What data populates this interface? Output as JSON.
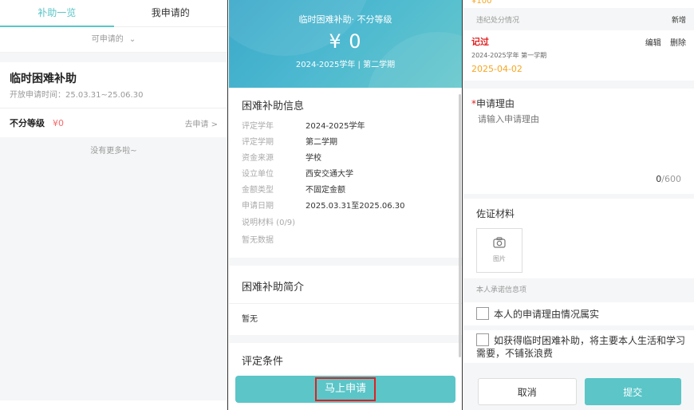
{
  "list": {
    "tabs": [
      "补助一览",
      "我申请的"
    ],
    "filter": "可申请的",
    "item": {
      "title": "临时困难补助",
      "open_time": "开放申请时间：25.03.31~25.06.30",
      "level": "不分等级",
      "amount": "¥0",
      "action": "去申请 >"
    },
    "no_more": "没有更多啦~"
  },
  "detail": {
    "banner_title": "临时困难补助· 不分等级",
    "banner_amount": "¥ 0",
    "banner_term": "2024-2025学年 | 第二学期",
    "info_title": "困难补助信息",
    "info": [
      {
        "k": "评定学年",
        "v": "2024-2025学年"
      },
      {
        "k": "评定学期",
        "v": "第二学期"
      },
      {
        "k": "资金来源",
        "v": "学校"
      },
      {
        "k": "设立单位",
        "v": "西安交通大学"
      },
      {
        "k": "金额类型",
        "v": "不固定金额"
      },
      {
        "k": "申请日期",
        "v": "2025.03.31至2025.06.30"
      }
    ],
    "materials": "说明材料 (0/9)",
    "no_data": "暂无数据",
    "brief_title": "困难补助简介",
    "brief": "暂无",
    "cond_title": "评定条件",
    "apply_button": "马上申请"
  },
  "form": {
    "top_amount": "¥100",
    "violation_head": "违纪处分情况",
    "add": "新增",
    "violation": {
      "type": "记过",
      "edit": "编辑",
      "delete": "删除",
      "term": "2024-2025学年 第一学期",
      "date": "2025-04-02"
    },
    "reason_label": "申请理由",
    "reason_placeholder": "请输入申请理由",
    "counter_current": "0",
    "counter_max": "/600",
    "evidence_label": "佐证材料",
    "evidence_caption": "图片",
    "promise_head": "本人承诺信息项",
    "promise1": "本人的申请理由情况属实",
    "promise2": "如获得临时困难补助，将主要本人生活和学习需要，不铺张浪费",
    "cancel": "取消",
    "submit": "提交"
  },
  "colors": {
    "accent": "#5bc5c8",
    "red": "#e02020",
    "orange": "#f5a623"
  }
}
